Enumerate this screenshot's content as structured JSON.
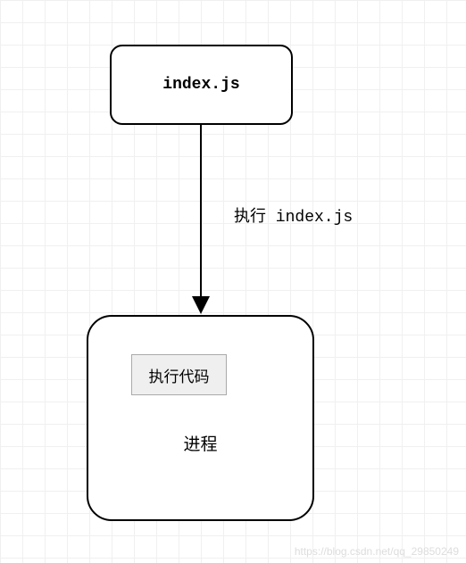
{
  "top_box": {
    "label": "index.js"
  },
  "arrow": {
    "label": "执行 index.js"
  },
  "bottom_box": {
    "inner_label": "执行代码",
    "label": "进程"
  },
  "watermark": "https://blog.csdn.net/qq_29850249"
}
